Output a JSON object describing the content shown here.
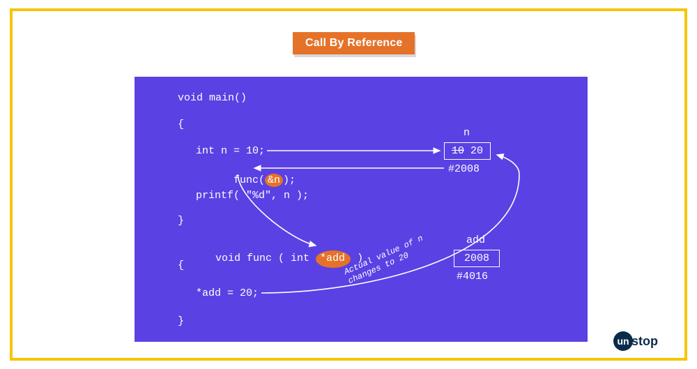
{
  "title": "Call By Reference",
  "code": {
    "l1": "void main()",
    "l2": "{",
    "l3a": "int n = 10;",
    "l4a": "func(",
    "l4hl": "&n",
    "l4b": ");",
    "l5": "printf( \"%d\", n );",
    "l6": "}",
    "l7a": "void func ( int ",
    "l7hl": "*add",
    "l7b": " )",
    "l8": "{",
    "l9": "*add = 20;",
    "l10": "}"
  },
  "vars": {
    "n": {
      "label": "n",
      "old": "10",
      "new": "20",
      "addr": "#2008"
    },
    "add": {
      "label": "add",
      "value": "2008",
      "addr": "#4016"
    }
  },
  "annotation": {
    "line1": "Actual value of n",
    "line2": "changes to 20"
  },
  "logo": {
    "circle": "un",
    "rest": "stop"
  }
}
